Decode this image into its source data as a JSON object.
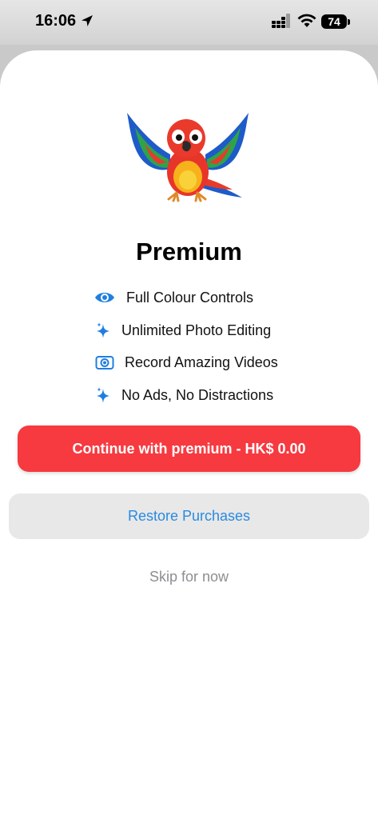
{
  "status_bar": {
    "time": "16:06",
    "battery": "74"
  },
  "paywall": {
    "title": "Premium",
    "features": [
      {
        "icon": "eye-icon",
        "label": "Full Colour Controls"
      },
      {
        "icon": "sparkles-icon",
        "label": "Unlimited Photo Editing"
      },
      {
        "icon": "record-camera-icon",
        "label": "Record Amazing Videos"
      },
      {
        "icon": "sparkles-icon",
        "label": "No Ads, No Distractions"
      }
    ],
    "premium_button": "Continue with premium -  HK$ 0.00",
    "restore_button": "Restore Purchases",
    "skip_link": "Skip for now"
  },
  "colors": {
    "accent": "#f63a40",
    "link": "#2a8ae0",
    "icon": "#1f7fe0"
  }
}
